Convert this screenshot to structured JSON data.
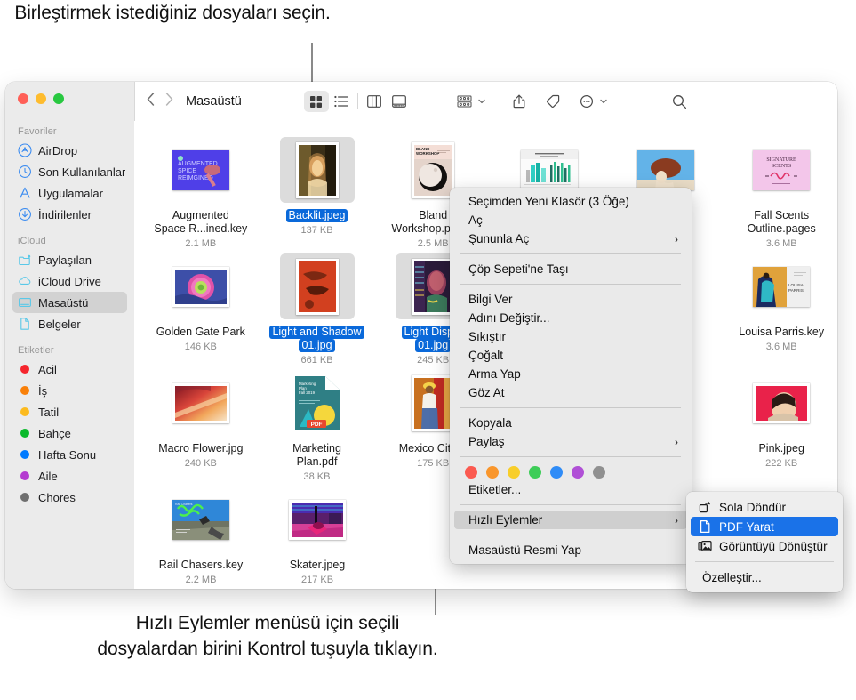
{
  "callouts": {
    "top": "Birleştirmek istediğiniz dosyaları seçin.",
    "bottom": "Hızlı Eylemler menüsü için seçili dosyalardan birini Kontrol tuşuyla tıklayın."
  },
  "window": {
    "title": "Masaüstü",
    "traffic_lights": [
      "close-red",
      "minimize-yellow",
      "zoom-green"
    ]
  },
  "toolbar": {
    "back_label": "‹",
    "forward_label": "›",
    "path_title": "Masaüstü",
    "buttons": [
      {
        "name": "icon-view-button",
        "label": "",
        "icon": "grid-view-icon",
        "active": true
      },
      {
        "name": "list-view-button",
        "label": "",
        "icon": "list-view-icon",
        "active": false
      },
      {
        "name": "column-view-button",
        "label": "",
        "icon": "column-view-icon",
        "active": false
      },
      {
        "name": "gallery-view-button",
        "label": "",
        "icon": "gallery-view-icon",
        "active": false
      },
      {
        "name": "group-by-button",
        "label": "",
        "icon": "group-by-icon",
        "active": false
      },
      {
        "name": "share-button",
        "label": "",
        "icon": "share-icon",
        "active": false
      },
      {
        "name": "tags-button",
        "label": "",
        "icon": "tag-icon",
        "active": false
      },
      {
        "name": "more-actions-button",
        "label": "",
        "icon": "ellipsis-circle-icon",
        "active": false
      },
      {
        "name": "search-button",
        "label": "",
        "icon": "search-icon",
        "active": false
      }
    ]
  },
  "sidebar": {
    "sections": [
      {
        "title": "Favoriler",
        "items": [
          {
            "label": "AirDrop",
            "icon": "airdrop-icon",
            "selected": false
          },
          {
            "label": "Son Kullanılanlar",
            "icon": "clock-icon",
            "selected": false
          },
          {
            "label": "Uygulamalar",
            "icon": "applications-icon",
            "selected": false
          },
          {
            "label": "İndirilenler",
            "icon": "downloads-icon",
            "selected": false
          }
        ]
      },
      {
        "title": "iCloud",
        "items": [
          {
            "label": "Paylaşılan",
            "icon": "shared-folder-icon",
            "selected": false
          },
          {
            "label": "iCloud Drive",
            "icon": "cloud-icon",
            "selected": false
          },
          {
            "label": "Masaüstü",
            "icon": "desktop-icon",
            "selected": true
          },
          {
            "label": "Belgeler",
            "icon": "document-icon",
            "selected": false
          }
        ]
      },
      {
        "title": "Etiketler",
        "items": [
          {
            "label": "Acil",
            "icon": "tag-dot-icon",
            "color": "#f5252d",
            "selected": false
          },
          {
            "label": "İş",
            "icon": "tag-dot-icon",
            "color": "#f98009",
            "selected": false
          },
          {
            "label": "Tatil",
            "icon": "tag-dot-icon",
            "color": "#fcbb1f",
            "selected": false
          },
          {
            "label": "Bahçe",
            "icon": "tag-dot-icon",
            "color": "#0ab92b",
            "selected": false
          },
          {
            "label": "Hafta Sonu",
            "icon": "tag-dot-icon",
            "color": "#007aff",
            "selected": false
          },
          {
            "label": "Aile",
            "icon": "tag-dot-icon",
            "color": "#b43ad0",
            "selected": false
          },
          {
            "label": "Chores",
            "icon": "tag-dot-icon",
            "color": "#6f6f6f",
            "selected": false
          }
        ]
      }
    ]
  },
  "files": {
    "rows": [
      [
        {
          "name": "Augmented\nSpace R...ined.key",
          "line1": "Augmented",
          "line2": "Space R...ined.key",
          "size": "2.1 MB",
          "selected": false,
          "kind": "keynote"
        },
        {
          "name": "Backlit.jpeg",
          "line1": "Backlit.jpeg",
          "line2": "",
          "size": "137 KB",
          "selected": true,
          "kind": "photo-portrait"
        },
        {
          "name": "Bland\nWorkshop.pages",
          "line1": "Bland",
          "line2": "Workshop.pages",
          "size": "2.5 MB",
          "selected": false,
          "kind": "pages"
        },
        {
          "name": "",
          "line1": "",
          "line2": "",
          "size": "",
          "selected": false,
          "kind": "chart-doc"
        },
        {
          "name": "",
          "line1": "",
          "line2": "",
          "size": "",
          "selected": false,
          "kind": "hat-photo"
        },
        {
          "name": "Fall Scents\nOutline.pages",
          "line1": "Fall Scents",
          "line2": "Outline.pages",
          "size": "3.6 MB",
          "selected": false,
          "kind": "scents"
        }
      ],
      [
        {
          "name": "Golden Gate Park",
          "line1": "Golden Gate Park",
          "line2": "",
          "size": "146 KB",
          "selected": false,
          "kind": "flower"
        },
        {
          "name": "Light and Shadow 01.jpg",
          "line1": "Light and Shadow",
          "line2": "01.jpg",
          "size": "661 KB",
          "selected": true,
          "kind": "shadow"
        },
        {
          "name": "Light Display 01.jpg",
          "line1": "Light Displa",
          "line2": "01.jpg",
          "size": "245 KB",
          "selected": true,
          "kind": "neon"
        },
        {
          "name": "",
          "line1": "",
          "line2": "",
          "size": "",
          "selected": false,
          "kind": "blank"
        },
        {
          "name": "",
          "line1": "",
          "line2": "",
          "size": "",
          "selected": false,
          "kind": "blank"
        },
        {
          "name": "Louisa Parris.key",
          "line1": "Louisa Parris.key",
          "line2": "",
          "size": "3.6 MB",
          "selected": false,
          "kind": "louisa"
        }
      ],
      [
        {
          "name": "Macro Flower.jpg",
          "line1": "Macro Flower.jpg",
          "line2": "",
          "size": "240 KB",
          "selected": false,
          "kind": "macro"
        },
        {
          "name": "Marketing\nPlan.pdf",
          "line1": "Marketing",
          "line2": "Plan.pdf",
          "size": "38 KB",
          "selected": false,
          "kind": "pdf"
        },
        {
          "name": "Mexico City.jpg",
          "line1": "Mexico City.jp",
          "line2": "",
          "size": "175 KB",
          "selected": false,
          "kind": "mexico"
        },
        {
          "name": "",
          "line1": "",
          "line2": "",
          "size": "",
          "selected": false,
          "kind": "blank"
        },
        {
          "name": "",
          "line1": "",
          "line2": "",
          "size": "",
          "selected": false,
          "kind": "blank"
        },
        {
          "name": "Pink.jpeg",
          "line1": "Pink.jpeg",
          "line2": "",
          "size": "222 KB",
          "selected": false,
          "kind": "pink"
        }
      ],
      [
        {
          "name": "Rail Chasers.key",
          "line1": "Rail Chasers.key",
          "line2": "",
          "size": "2.2 MB",
          "selected": false,
          "kind": "rail"
        },
        {
          "name": "Skater.jpeg",
          "line1": "Skater.jpeg",
          "line2": "",
          "size": "217 KB",
          "selected": false,
          "kind": "skater"
        }
      ]
    ]
  },
  "context_menu": {
    "items": [
      {
        "label": "Seçimden Yeni Klasör (3 Öğe)",
        "submenu": false,
        "highlighted": false
      },
      {
        "label": "Aç",
        "submenu": false,
        "highlighted": false
      },
      {
        "label": "Şununla Aç",
        "submenu": true,
        "highlighted": false
      },
      {
        "separator": true
      },
      {
        "label": "Çöp Sepeti'ne Taşı",
        "submenu": false,
        "highlighted": false
      },
      {
        "separator": true
      },
      {
        "label": "Bilgi Ver",
        "submenu": false,
        "highlighted": false
      },
      {
        "label": "Adını Değiştir...",
        "submenu": false,
        "highlighted": false
      },
      {
        "label": "Sıkıştır",
        "submenu": false,
        "highlighted": false
      },
      {
        "label": "Çoğalt",
        "submenu": false,
        "highlighted": false
      },
      {
        "label": "Arma Yap",
        "submenu": false,
        "highlighted": false
      },
      {
        "label": "Göz At",
        "submenu": false,
        "highlighted": false
      },
      {
        "separator": true
      },
      {
        "label": "Kopyala",
        "submenu": false,
        "highlighted": false
      },
      {
        "label": "Paylaş",
        "submenu": true,
        "highlighted": false
      },
      {
        "separator": true
      },
      {
        "swatches": true
      },
      {
        "label": "Etiketler...",
        "submenu": false,
        "highlighted": false
      },
      {
        "separator": true
      },
      {
        "label": "Hızlı Eylemler",
        "submenu": true,
        "highlighted": true
      },
      {
        "separator": true
      },
      {
        "label": "Masaüstü Resmi Yap",
        "submenu": false,
        "highlighted": false
      }
    ],
    "tag_colors": [
      "#fb5a50",
      "#f9962c",
      "#f8ce2a",
      "#3ecd58",
      "#2f8cf7",
      "#b050d6",
      "#909090"
    ]
  },
  "submenu": {
    "items": [
      {
        "label": "Sola Döndür",
        "icon": "rotate-left-icon",
        "selected": false
      },
      {
        "label": "PDF Yarat",
        "icon": "pdf-document-icon",
        "selected": true
      },
      {
        "label": "Görüntüyü Dönüştür",
        "icon": "convert-image-icon",
        "selected": false
      },
      {
        "separator": true
      },
      {
        "label": "Özelleştir...",
        "icon": "",
        "selected": false
      }
    ]
  },
  "colors": {
    "accent": "#1a72e8",
    "selection_label": "#0a69da",
    "sidebar_bg": "#ebebeb",
    "menu_bg": "#eaeaea"
  }
}
